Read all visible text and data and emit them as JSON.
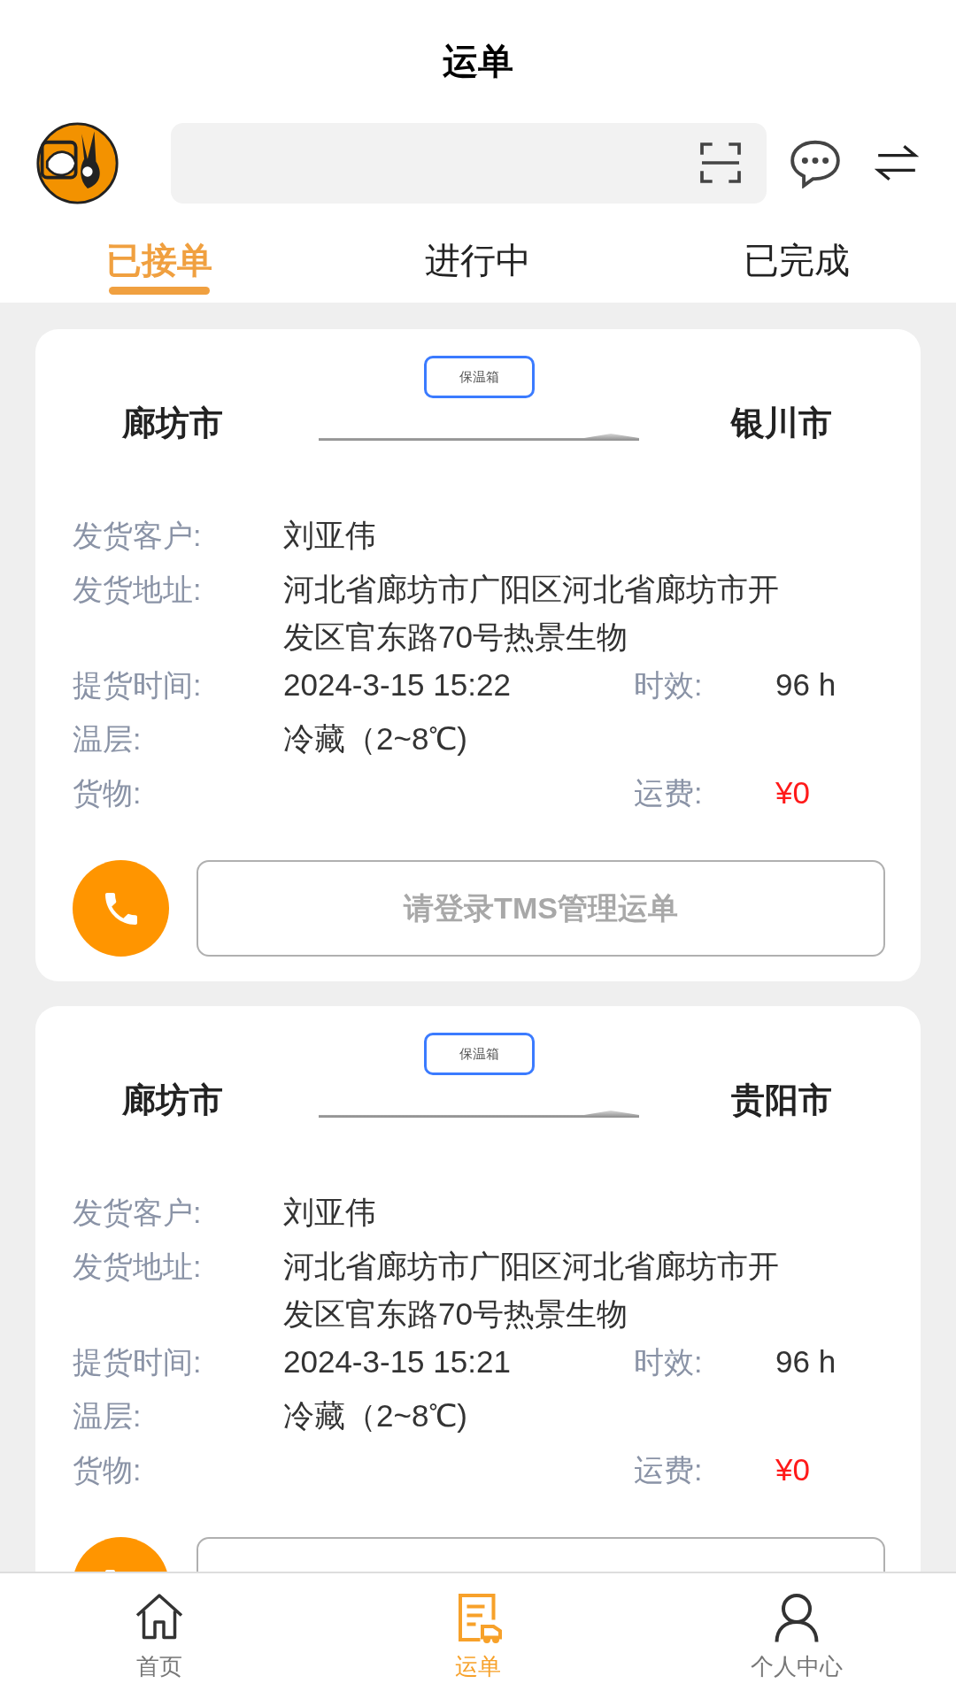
{
  "header": {
    "title": "运单"
  },
  "tabs": [
    {
      "label": "已接单",
      "selected": true
    },
    {
      "label": "进行中",
      "selected": false
    },
    {
      "label": "已完成",
      "selected": false
    }
  ],
  "orders": [
    {
      "badge": "保温箱",
      "origin": "廊坊市",
      "destination": "银川市",
      "shipper": {
        "label": "发货客户:",
        "value": "刘亚伟"
      },
      "address": {
        "label": "发货地址:",
        "value": "河北省廊坊市广阳区河北省廊坊市开发区官东路70号热景生物"
      },
      "pickup_time": {
        "label": "提货时间:",
        "value": "2024-3-15 15:22"
      },
      "validity": {
        "label": "时效:",
        "value": "96 h"
      },
      "temperature": {
        "label": "温层:",
        "value": "冷藏（2~8℃)"
      },
      "cargo": {
        "label": "货物:"
      },
      "freight": {
        "label": "运费:",
        "value": "¥0"
      },
      "action": {
        "label": "请登录TMS管理运单"
      }
    },
    {
      "badge": "保温箱",
      "origin": "廊坊市",
      "destination": "贵阳市",
      "shipper": {
        "label": "发货客户:",
        "value": "刘亚伟"
      },
      "address": {
        "label": "发货地址:",
        "value": "河北省廊坊市广阳区河北省廊坊市开发区官东路70号热景生物"
      },
      "pickup_time": {
        "label": "提货时间:",
        "value": "2024-3-15 15:21"
      },
      "validity": {
        "label": "时效:",
        "value": "96 h"
      },
      "temperature": {
        "label": "温层:",
        "value": "冷藏（2~8℃)"
      },
      "cargo": {
        "label": "货物:"
      },
      "freight": {
        "label": "运费:",
        "value": "¥0"
      }
    }
  ],
  "bottom_nav": [
    {
      "label": "首页",
      "selected": false
    },
    {
      "label": "运单",
      "selected": true
    },
    {
      "label": "个人中心",
      "selected": false
    }
  ]
}
